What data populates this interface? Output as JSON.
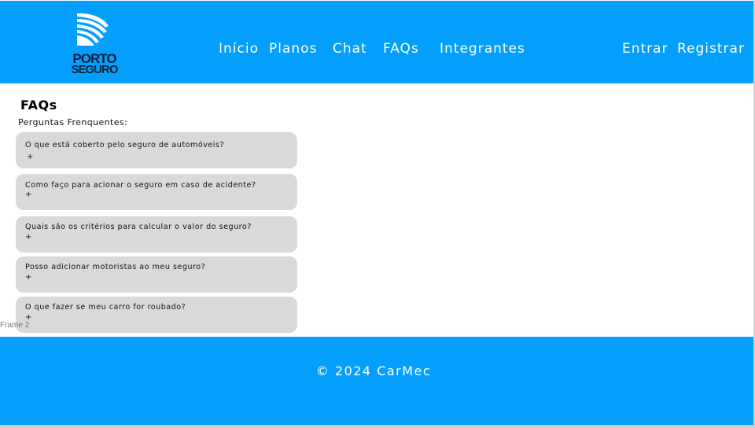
{
  "header": {
    "logo": {
      "line1": "PORTO",
      "line2": "SEGURO"
    },
    "nav": [
      "Início",
      "Planos",
      "Chat",
      "FAQs",
      "Integrantes"
    ],
    "auth": {
      "login": "Entrar",
      "register": "Registrar"
    }
  },
  "main": {
    "title": "FAQs",
    "subtitle": "Perguntas Frenquentes:",
    "faqs": [
      {
        "question": "O que está coberto pelo seguro de automóveis?",
        "toggle": "+"
      },
      {
        "question": "Como faço para acionar o seguro em caso de acidente?",
        "toggle": "+"
      },
      {
        "question": "Quais são os critérios para calcular o valor do seguro?",
        "toggle": "+"
      },
      {
        "question": "Posso adicionar motoristas ao meu seguro?",
        "toggle": "+"
      },
      {
        "question": "O que fazer se meu carro for roubado?",
        "toggle": "+"
      }
    ]
  },
  "frame_label": "Frame 2",
  "footer": {
    "copyright": "© 2024 CarMec"
  },
  "colors": {
    "brand_blue": "#049ffc",
    "faq_card": "#d9d9d9",
    "logo_dark": "#07213a"
  }
}
